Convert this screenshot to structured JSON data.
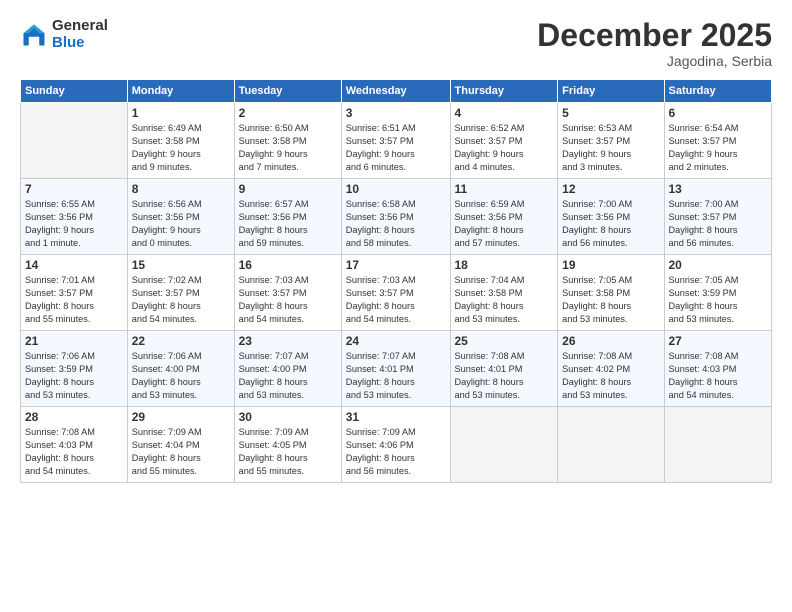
{
  "logo": {
    "general": "General",
    "blue": "Blue"
  },
  "header": {
    "month": "December 2025",
    "location": "Jagodina, Serbia"
  },
  "weekdays": [
    "Sunday",
    "Monday",
    "Tuesday",
    "Wednesday",
    "Thursday",
    "Friday",
    "Saturday"
  ],
  "weeks": [
    [
      {
        "day": "",
        "info": ""
      },
      {
        "day": "1",
        "info": "Sunrise: 6:49 AM\nSunset: 3:58 PM\nDaylight: 9 hours\nand 9 minutes."
      },
      {
        "day": "2",
        "info": "Sunrise: 6:50 AM\nSunset: 3:58 PM\nDaylight: 9 hours\nand 7 minutes."
      },
      {
        "day": "3",
        "info": "Sunrise: 6:51 AM\nSunset: 3:57 PM\nDaylight: 9 hours\nand 6 minutes."
      },
      {
        "day": "4",
        "info": "Sunrise: 6:52 AM\nSunset: 3:57 PM\nDaylight: 9 hours\nand 4 minutes."
      },
      {
        "day": "5",
        "info": "Sunrise: 6:53 AM\nSunset: 3:57 PM\nDaylight: 9 hours\nand 3 minutes."
      },
      {
        "day": "6",
        "info": "Sunrise: 6:54 AM\nSunset: 3:57 PM\nDaylight: 9 hours\nand 2 minutes."
      }
    ],
    [
      {
        "day": "7",
        "info": "Sunrise: 6:55 AM\nSunset: 3:56 PM\nDaylight: 9 hours\nand 1 minute."
      },
      {
        "day": "8",
        "info": "Sunrise: 6:56 AM\nSunset: 3:56 PM\nDaylight: 9 hours\nand 0 minutes."
      },
      {
        "day": "9",
        "info": "Sunrise: 6:57 AM\nSunset: 3:56 PM\nDaylight: 8 hours\nand 59 minutes."
      },
      {
        "day": "10",
        "info": "Sunrise: 6:58 AM\nSunset: 3:56 PM\nDaylight: 8 hours\nand 58 minutes."
      },
      {
        "day": "11",
        "info": "Sunrise: 6:59 AM\nSunset: 3:56 PM\nDaylight: 8 hours\nand 57 minutes."
      },
      {
        "day": "12",
        "info": "Sunrise: 7:00 AM\nSunset: 3:56 PM\nDaylight: 8 hours\nand 56 minutes."
      },
      {
        "day": "13",
        "info": "Sunrise: 7:00 AM\nSunset: 3:57 PM\nDaylight: 8 hours\nand 56 minutes."
      }
    ],
    [
      {
        "day": "14",
        "info": "Sunrise: 7:01 AM\nSunset: 3:57 PM\nDaylight: 8 hours\nand 55 minutes."
      },
      {
        "day": "15",
        "info": "Sunrise: 7:02 AM\nSunset: 3:57 PM\nDaylight: 8 hours\nand 54 minutes."
      },
      {
        "day": "16",
        "info": "Sunrise: 7:03 AM\nSunset: 3:57 PM\nDaylight: 8 hours\nand 54 minutes."
      },
      {
        "day": "17",
        "info": "Sunrise: 7:03 AM\nSunset: 3:57 PM\nDaylight: 8 hours\nand 54 minutes."
      },
      {
        "day": "18",
        "info": "Sunrise: 7:04 AM\nSunset: 3:58 PM\nDaylight: 8 hours\nand 53 minutes."
      },
      {
        "day": "19",
        "info": "Sunrise: 7:05 AM\nSunset: 3:58 PM\nDaylight: 8 hours\nand 53 minutes."
      },
      {
        "day": "20",
        "info": "Sunrise: 7:05 AM\nSunset: 3:59 PM\nDaylight: 8 hours\nand 53 minutes."
      }
    ],
    [
      {
        "day": "21",
        "info": "Sunrise: 7:06 AM\nSunset: 3:59 PM\nDaylight: 8 hours\nand 53 minutes."
      },
      {
        "day": "22",
        "info": "Sunrise: 7:06 AM\nSunset: 4:00 PM\nDaylight: 8 hours\nand 53 minutes."
      },
      {
        "day": "23",
        "info": "Sunrise: 7:07 AM\nSunset: 4:00 PM\nDaylight: 8 hours\nand 53 minutes."
      },
      {
        "day": "24",
        "info": "Sunrise: 7:07 AM\nSunset: 4:01 PM\nDaylight: 8 hours\nand 53 minutes."
      },
      {
        "day": "25",
        "info": "Sunrise: 7:08 AM\nSunset: 4:01 PM\nDaylight: 8 hours\nand 53 minutes."
      },
      {
        "day": "26",
        "info": "Sunrise: 7:08 AM\nSunset: 4:02 PM\nDaylight: 8 hours\nand 53 minutes."
      },
      {
        "day": "27",
        "info": "Sunrise: 7:08 AM\nSunset: 4:03 PM\nDaylight: 8 hours\nand 54 minutes."
      }
    ],
    [
      {
        "day": "28",
        "info": "Sunrise: 7:08 AM\nSunset: 4:03 PM\nDaylight: 8 hours\nand 54 minutes."
      },
      {
        "day": "29",
        "info": "Sunrise: 7:09 AM\nSunset: 4:04 PM\nDaylight: 8 hours\nand 55 minutes."
      },
      {
        "day": "30",
        "info": "Sunrise: 7:09 AM\nSunset: 4:05 PM\nDaylight: 8 hours\nand 55 minutes."
      },
      {
        "day": "31",
        "info": "Sunrise: 7:09 AM\nSunset: 4:06 PM\nDaylight: 8 hours\nand 56 minutes."
      },
      {
        "day": "",
        "info": ""
      },
      {
        "day": "",
        "info": ""
      },
      {
        "day": "",
        "info": ""
      }
    ]
  ]
}
